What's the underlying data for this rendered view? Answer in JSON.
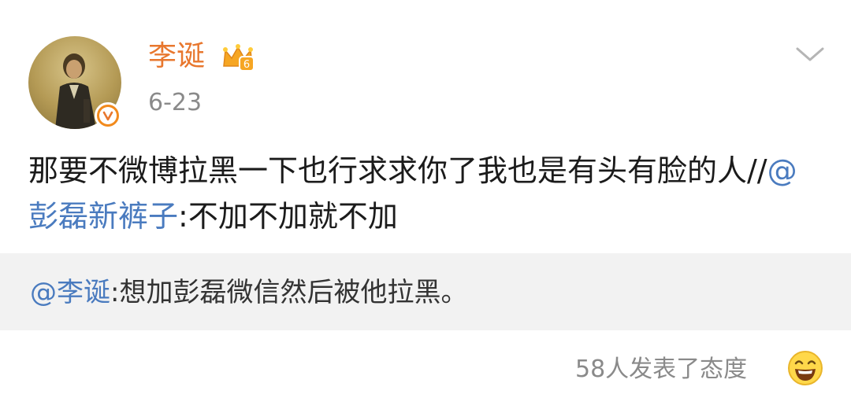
{
  "user": {
    "name": "李诞",
    "member_level": "6",
    "date": "6-23"
  },
  "post": {
    "text_before": "那要不微博拉黑一下也行求求你了我也是有头有脸的人//",
    "mention": "@彭磊新裤子",
    "text_after": ":不加不加就不加"
  },
  "repost": {
    "mention": "@李诞",
    "text": ":想加彭磊微信然后被他拉黑。"
  },
  "reactions": {
    "label": "58人发表了态度"
  },
  "colors": {
    "username": "#e8772e",
    "mention": "#4a7bbf",
    "verified": "#f28a1c",
    "repost_bg": "#f2f2f2"
  },
  "icons": {
    "badge": "crown-badge-icon",
    "verified": "verified-v-icon",
    "menu": "chevron-down-icon",
    "reaction": "laughing-emoji-icon"
  }
}
